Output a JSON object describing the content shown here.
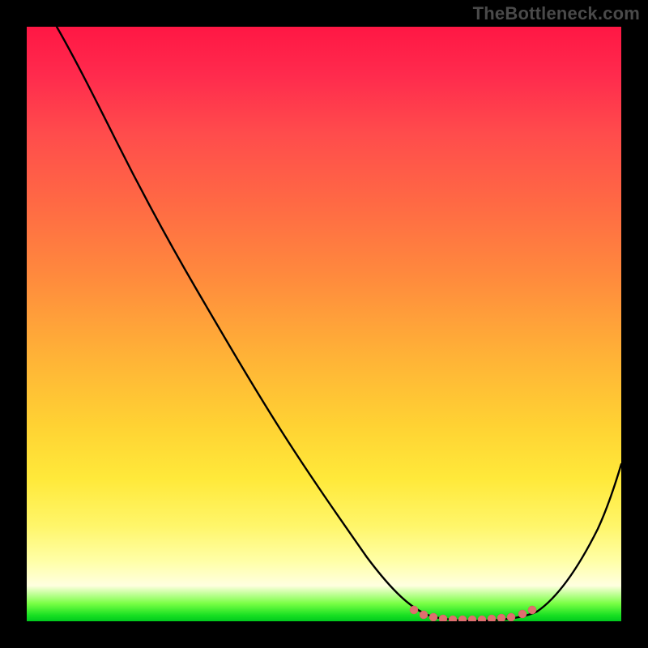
{
  "watermark": "TheBottleneck.com",
  "chart_data": {
    "type": "line",
    "title": "",
    "xlabel": "",
    "ylabel": "",
    "xlim": [
      0,
      100
    ],
    "ylim": [
      0,
      100
    ],
    "grid": false,
    "legend": false,
    "series": [
      {
        "name": "curve",
        "x": [
          5,
          10,
          15,
          20,
          25,
          30,
          35,
          40,
          45,
          50,
          55,
          60,
          65,
          68,
          72,
          76,
          80,
          84,
          88,
          92,
          96,
          100
        ],
        "y": [
          100,
          94,
          87,
          79,
          71,
          63,
          55,
          47,
          39,
          31,
          23,
          17,
          11,
          6,
          2,
          0,
          0,
          0,
          2,
          8,
          18,
          30
        ]
      }
    ],
    "marker_region": {
      "name": "valley-markers",
      "x": [
        66,
        68,
        70,
        72,
        74,
        76,
        78,
        80,
        82,
        84,
        86
      ],
      "y": [
        3,
        1.5,
        0.8,
        0.3,
        0.1,
        0,
        0,
        0.1,
        0.3,
        0.8,
        1.8
      ]
    },
    "colors": {
      "curve": "#000000",
      "markers": "#e06666",
      "background_top": "#ff1744",
      "background_bottom": "#00c91e"
    }
  }
}
